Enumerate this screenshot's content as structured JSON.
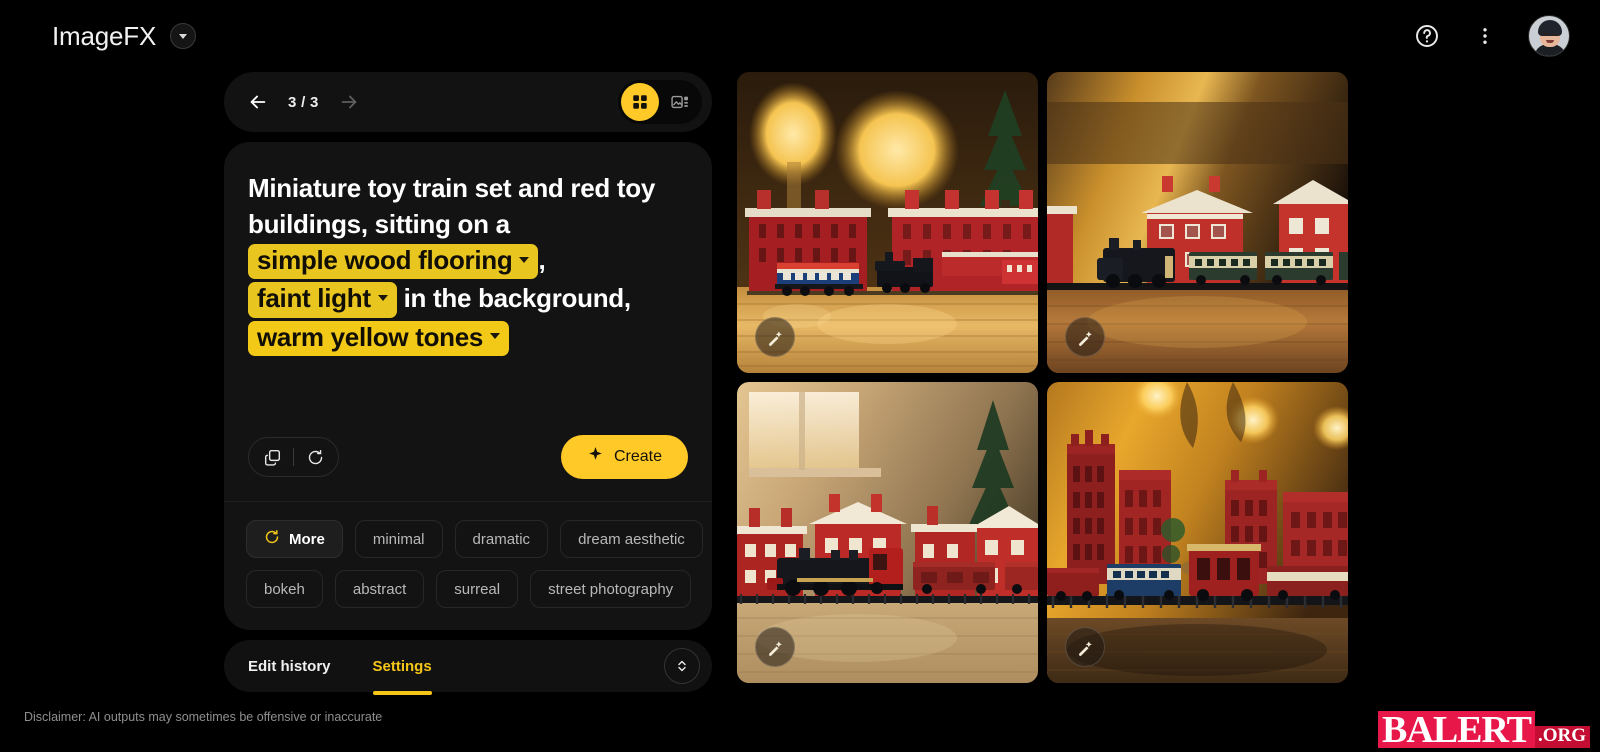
{
  "header": {
    "brand": "ImageFX",
    "brand_caret_icon": "chevron-down-icon",
    "help_icon": "help-circle-icon",
    "menu_icon": "more-vertical-icon",
    "avatar_icon": "user-avatar"
  },
  "nav": {
    "back_icon": "arrow-left-icon",
    "forward_icon": "arrow-right-icon",
    "page_count": "3 / 3",
    "grid_view_icon": "grid-view-icon",
    "single_view_icon": "image-detail-view-icon",
    "active_view": "grid"
  },
  "prompt": {
    "segments": [
      {
        "type": "text",
        "value": "Miniature toy train set and red toy buildings, sitting on a "
      },
      {
        "type": "chip",
        "value": "simple wood flooring"
      },
      {
        "type": "text",
        "value": ", "
      },
      {
        "type": "chip",
        "value": "faint light"
      },
      {
        "type": "text",
        "value": " in the background, "
      },
      {
        "type": "chip",
        "value": "warm yellow tones"
      }
    ],
    "line1": "Miniature toy train set and red toy",
    "line2": "buildings, sitting on a",
    "chip1": "simple wood flooring",
    "comma": ",",
    "chip2": "faint light",
    "mid_text": "in the background,",
    "chip3": "warm yellow tones",
    "copy_icon": "copy-icon",
    "reset_icon": "reset-icon",
    "create_label": "Create",
    "create_icon": "sparkle-icon"
  },
  "suggestions": {
    "row1": [
      {
        "label": "More",
        "icon": "refresh-icon",
        "primary": true
      },
      {
        "label": "minimal",
        "primary": false
      },
      {
        "label": "dramatic",
        "primary": false
      },
      {
        "label": "dream aesthetic",
        "primary": false
      }
    ],
    "row2": [
      {
        "label": "bokeh",
        "primary": false
      },
      {
        "label": "abstract",
        "primary": false
      },
      {
        "label": "surreal",
        "primary": false
      },
      {
        "label": "street photography",
        "primary": false
      }
    ]
  },
  "tabs": {
    "items": [
      {
        "label": "Edit history",
        "active": false
      },
      {
        "label": "Settings",
        "active": true
      }
    ],
    "expand_icon": "expand-collapse-icon"
  },
  "gallery": {
    "edit_icon": "magic-wand-edit-icon",
    "tiles": [
      {
        "alt": "Blue and black toy train on wood floor with red buildings and glowing lamps"
      },
      {
        "alt": "Black steam locomotive with green cream carriages beside red school buildings"
      },
      {
        "alt": "Black and red locomotive with freight cars before red buildings and window light"
      },
      {
        "alt": "Red brick city buildings with toy train and warm bokeh lights"
      }
    ]
  },
  "footer": {
    "disclaimer": "Disclaimer: AI outputs may sometimes be offensive or inaccurate",
    "watermark_main": "BALERT",
    "watermark_org": ".ORG"
  },
  "colors": {
    "accent_yellow": "#ffc928",
    "chip_yellow": "#e9c520",
    "tab_active": "#f5c518",
    "background": "#000000",
    "panel": "#131313",
    "watermark_red": "#e8174a"
  }
}
